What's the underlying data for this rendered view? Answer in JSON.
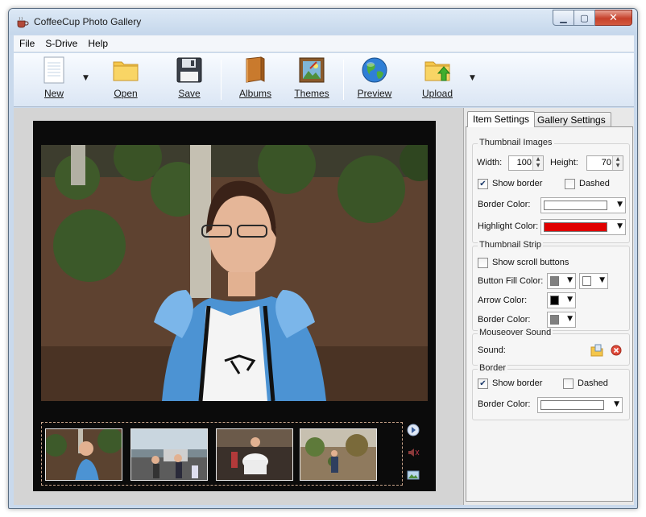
{
  "window": {
    "title": "CoffeeCup Photo Gallery"
  },
  "menu": [
    "File",
    "S-Drive",
    "Help"
  ],
  "toolbar": {
    "new": "New",
    "open": "Open",
    "save": "Save",
    "albums": "Albums",
    "themes": "Themes",
    "preview": "Preview",
    "upload": "Upload"
  },
  "tabs": {
    "item_settings": "Item Settings",
    "gallery_settings": "Gallery Settings"
  },
  "thumbnail_images": {
    "title": "Thumbnail Images",
    "width_label": "Width:",
    "width_value": "100",
    "height_label": "Height:",
    "height_value": "70",
    "show_border_label": "Show border",
    "show_border_checked": true,
    "dashed_label": "Dashed",
    "dashed_checked": false,
    "border_color_label": "Border Color:",
    "border_color": "#ffffff",
    "highlight_color_label": "Highlight Color:",
    "highlight_color": "#e00000"
  },
  "thumbnail_strip": {
    "title": "Thumbnail Strip",
    "show_scroll_label": "Show scroll buttons",
    "show_scroll_checked": false,
    "button_fill_label": "Button Fill Color:",
    "button_fill_color": "#808080",
    "button_fill_color2": "#ffffff",
    "arrow_color_label": "Arrow Color:",
    "arrow_color": "#000000",
    "border_color_label": "Border Color:",
    "border_color": "#808080"
  },
  "mouseover_sound": {
    "title": "Mouseover Sound",
    "sound_label": "Sound:"
  },
  "border": {
    "title": "Border",
    "show_border_label": "Show border",
    "show_border_checked": true,
    "dashed_label": "Dashed",
    "dashed_checked": false,
    "border_color_label": "Border Color:",
    "border_color": "#ffffff"
  },
  "icons": {
    "title_icon": "coffee-cup-icon",
    "new": "new-document-icon",
    "open": "folder-icon",
    "save": "floppy-disk-icon",
    "albums": "album-book-icon",
    "themes": "framed-picture-icon",
    "preview": "globe-icon",
    "upload": "upload-folder-icon"
  }
}
